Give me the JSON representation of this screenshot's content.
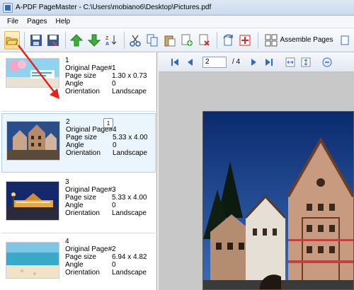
{
  "window": {
    "title": "A-PDF PageMaster - C:\\Users\\mobiano6\\Desktop\\Pictures.pdf"
  },
  "menu": {
    "items": [
      "File",
      "Pages",
      "Help"
    ]
  },
  "toolbar": {
    "buttons": [
      "open-icon",
      "save-icon",
      "save-as-icon",
      "move-up-icon",
      "move-down-icon",
      "sort-icon",
      "cut-icon",
      "copy-icon",
      "paste-icon",
      "insert-icon",
      "delete-icon",
      "rotate-icon",
      "extract-icon",
      "assemble-icon"
    ],
    "assemble_label": "Assemble Pages"
  },
  "thumbnails": [
    {
      "index": "1",
      "original_page_label": "Original Page#",
      "original_page": "1",
      "page_size_label": "Page size",
      "page_size": "1.30 x 0.73",
      "angle_label": "Angle",
      "angle": "0",
      "orientation_label": "Orientation",
      "orientation": "Landscape"
    },
    {
      "index": "2",
      "original_page_label": "Original Page#",
      "original_page": "4",
      "page_size_label": "Page size",
      "page_size": "5.33 x 4.00",
      "angle_label": "Angle",
      "angle": "0",
      "orientation_label": "Orientation",
      "orientation": "Landscape"
    },
    {
      "index": "3",
      "original_page_label": "Original Page#",
      "original_page": "3",
      "page_size_label": "Page size",
      "page_size": "5.33 x 4.00",
      "angle_label": "Angle",
      "angle": "0",
      "orientation_label": "Orientation",
      "orientation": "Landscape"
    },
    {
      "index": "4",
      "original_page_label": "Original Page#",
      "original_page": "2",
      "page_size_label": "Page size",
      "page_size": "6.94 x 4.82",
      "angle_label": "Angle",
      "angle": "0",
      "orientation_label": "Orientation",
      "orientation": "Landscape"
    }
  ],
  "tooltip": {
    "text": "1"
  },
  "navigation": {
    "current_page": "2",
    "total_pages": "/ 4"
  },
  "colors": {
    "accent": "#2b6cc4",
    "selected_bg": "#eaf5fd",
    "viewer_bg": "#c8c8c8"
  }
}
